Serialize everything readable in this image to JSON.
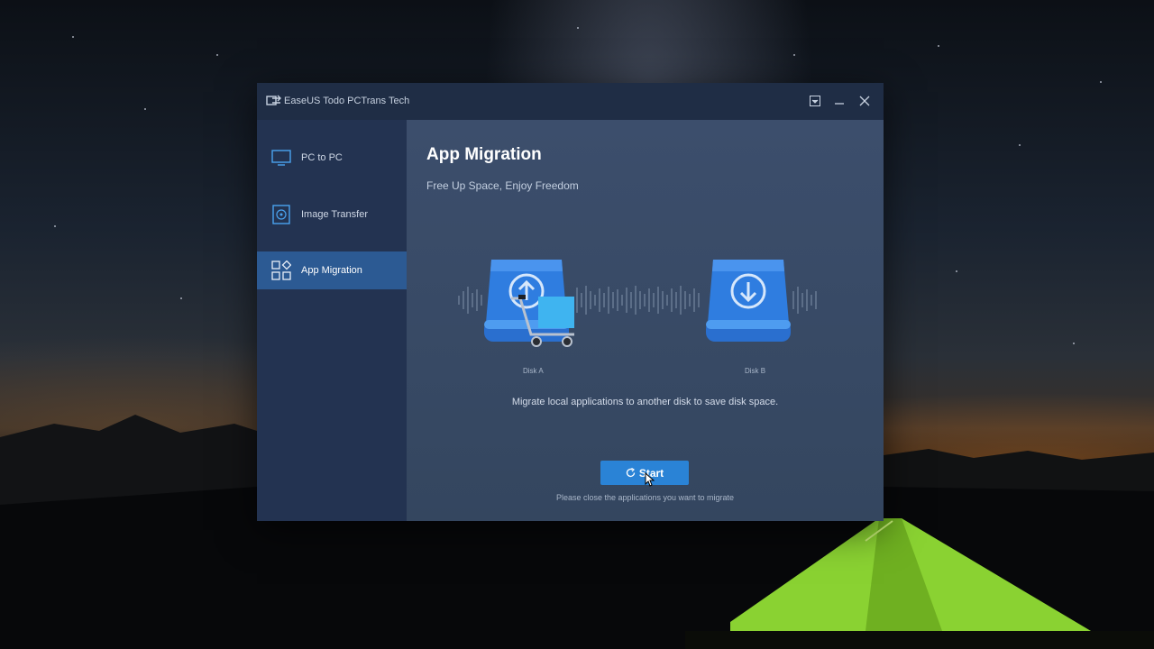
{
  "window": {
    "title": "EaseUS Todo PCTrans Tech"
  },
  "sidebar": {
    "items": [
      {
        "label": "PC to PC",
        "icon": "monitor-icon",
        "active": false
      },
      {
        "label": "Image Transfer",
        "icon": "disc-icon",
        "active": false
      },
      {
        "label": "App Migration",
        "icon": "apps-grid-icon",
        "active": true
      }
    ]
  },
  "main": {
    "title": "App Migration",
    "subtitle": "Free Up Space, Enjoy Freedom",
    "disk_a_label": "Disk A",
    "disk_b_label": "Disk B",
    "description": "Migrate local applications to another disk to save disk space.",
    "start_label": "Start",
    "hint": "Please close the applications you want to migrate"
  },
  "colors": {
    "titlebar": "#1f2d45",
    "sidebar": "#233351",
    "active_item": "#2c5a93",
    "main_bg": "#3c4e6c",
    "accent_button": "#2a83d6",
    "disk_blue": "#2f7de0",
    "cart_box": "#3fb4f0"
  }
}
